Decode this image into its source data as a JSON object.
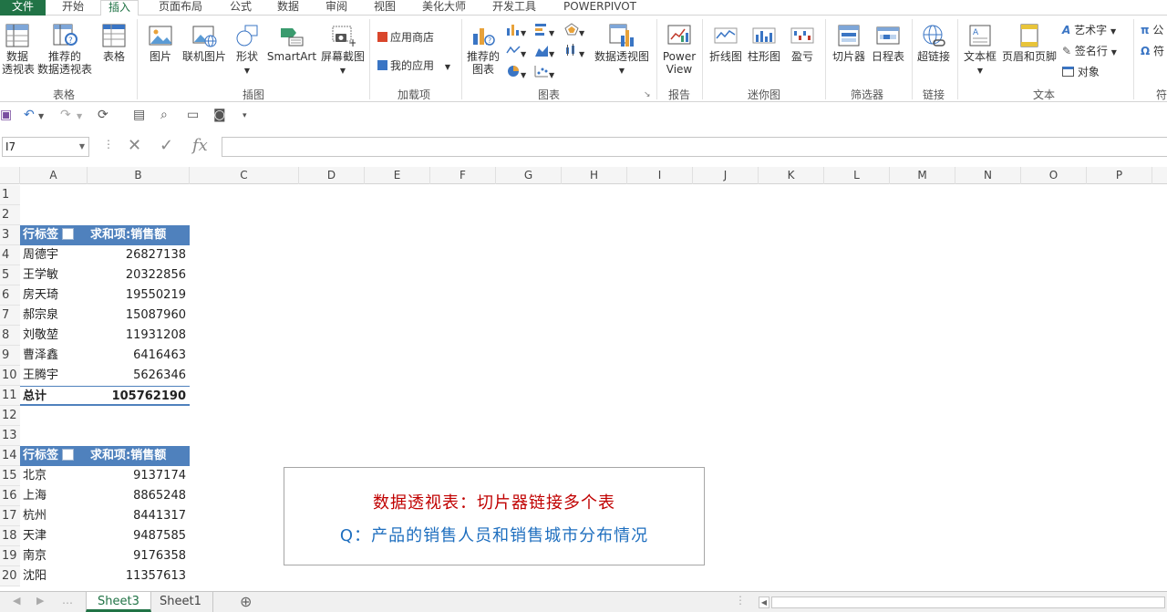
{
  "menubar": {
    "file": "文件",
    "tabs": [
      "开始",
      "插入",
      "页面布局",
      "公式",
      "数据",
      "审阅",
      "视图",
      "美化大师",
      "开发工具",
      "POWERPIVOT"
    ]
  },
  "ribbon": {
    "groups": {
      "tables": "表格",
      "illustrations": "插图",
      "addins": "加载项",
      "charts": "图表",
      "reports": "报告",
      "sparklines": "迷你图",
      "filters": "筛选器",
      "links": "链接",
      "text": "文本",
      "symbols": "符"
    },
    "buttons": {
      "pivot_l1": "数据",
      "pivot_l2": "透视表",
      "rec_pivot_l1": "推荐的",
      "rec_pivot_l2": "数据透视表",
      "table": "表格",
      "picture": "图片",
      "online_picture": "联机图片",
      "shapes": "形状",
      "smartart": "SmartArt",
      "screenshot": "屏幕截图",
      "store": "应用商店",
      "my_apps": "我的应用",
      "rec_chart_l1": "推荐的",
      "rec_chart_l2": "图表",
      "pivot_chart": "数据透视图",
      "power_l1": "Power",
      "power_l2": "View",
      "line": "折线图",
      "column": "柱形图",
      "winloss": "盈亏",
      "slicer": "切片器",
      "timeline": "日程表",
      "hyperlink": "超链接",
      "textbox": "文本框",
      "header_footer": "页眉和页脚",
      "wordart": "艺术字",
      "signature": "签名行",
      "object": "对象",
      "equation": "公",
      "symbol": "符"
    }
  },
  "formula_bar": {
    "name_box": "I7",
    "fx": "fx",
    "value": ""
  },
  "grid": {
    "columns": [
      "A",
      "B",
      "C",
      "D",
      "E",
      "F",
      "G",
      "H",
      "I",
      "J",
      "K",
      "L",
      "M",
      "N",
      "O",
      "P"
    ],
    "rows": [
      "1",
      "2",
      "3",
      "4",
      "5",
      "6",
      "7",
      "8",
      "9",
      "10",
      "11",
      "12",
      "13",
      "14",
      "15",
      "16",
      "17",
      "18",
      "19",
      "20"
    ]
  },
  "pivot1": {
    "header_label": "行标签",
    "header_value": "求和项:销售额",
    "rows": [
      {
        "name": "周德宇",
        "value": "26827138"
      },
      {
        "name": "王学敏",
        "value": "20322856"
      },
      {
        "name": "房天琦",
        "value": "19550219"
      },
      {
        "name": "郝宗泉",
        "value": "15087960"
      },
      {
        "name": "刘敬堃",
        "value": "11931208"
      },
      {
        "name": "曹泽鑫",
        "value": "6416463"
      },
      {
        "name": "王腾宇",
        "value": "5626346"
      }
    ],
    "total_label": "总计",
    "total_value": "105762190"
  },
  "pivot2": {
    "header_label": "行标签",
    "header_value": "求和项:销售额",
    "rows": [
      {
        "name": "北京",
        "value": "9137174"
      },
      {
        "name": "上海",
        "value": "8865248"
      },
      {
        "name": "杭州",
        "value": "8441317"
      },
      {
        "name": "天津",
        "value": "9487585"
      },
      {
        "name": "南京",
        "value": "9176358"
      },
      {
        "name": "沈阳",
        "value": "11357613"
      }
    ]
  },
  "note": {
    "title": "数据透视表：切片器链接多个表",
    "question": "Q：产品的销售人员和销售城市分布情况"
  },
  "sheets": {
    "active": "Sheet3",
    "other": "Sheet1",
    "add": "⊕"
  }
}
